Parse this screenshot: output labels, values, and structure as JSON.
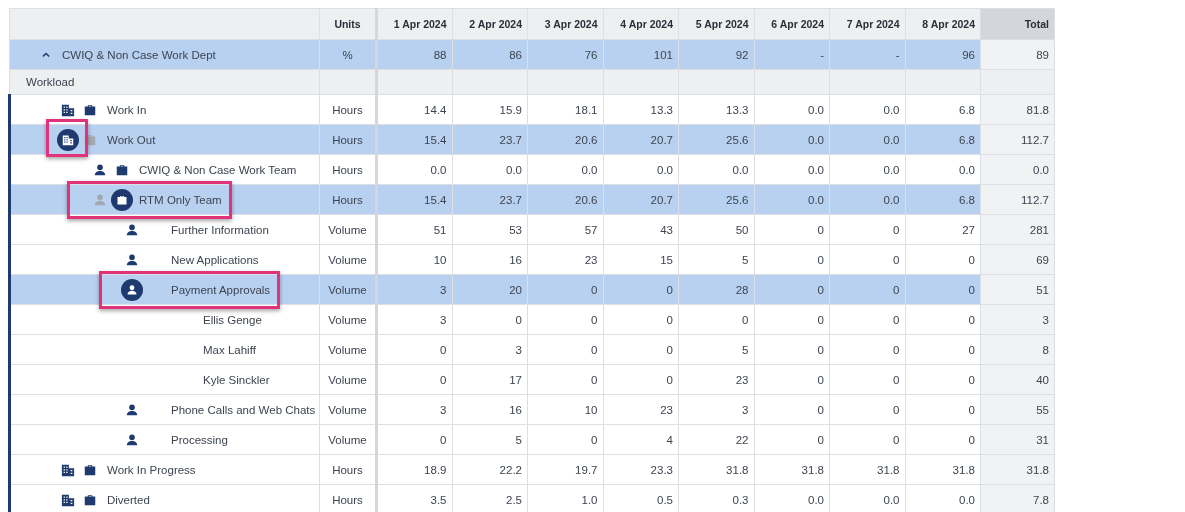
{
  "table": {
    "columns": [
      "Units",
      "1 Apr 2024",
      "2 Apr 2024",
      "3 Apr 2024",
      "4 Apr 2024",
      "5 Apr 2024",
      "6 Apr 2024",
      "7 Apr 2024",
      "8 Apr 2024",
      "Total"
    ],
    "dept": {
      "label": "CWIQ & Non Case Work Dept",
      "expanded": true,
      "selected": true,
      "units": "%",
      "values": [
        "88",
        "86",
        "76",
        "101",
        "92",
        "-",
        "-",
        "96"
      ],
      "total": "89"
    },
    "section": {
      "label": "Workload"
    },
    "rows": [
      {
        "label": "Work In",
        "selected": false,
        "icon_framed": false,
        "label_framed": false,
        "icons": [
          {
            "kind": "building",
            "circled": false,
            "faded": false
          },
          {
            "kind": "briefcase",
            "circled": false,
            "faded": false
          }
        ],
        "units": "Hours",
        "values": [
          "14.4",
          "15.9",
          "18.1",
          "13.3",
          "13.3",
          "0.0",
          "0.0",
          "6.8"
        ],
        "total": "81.8"
      },
      {
        "label": "Work Out",
        "selected": true,
        "icon_framed": true,
        "label_framed": false,
        "icons": [
          {
            "kind": "building",
            "circled": true,
            "faded": false
          },
          {
            "kind": "briefcase",
            "circled": false,
            "faded": true
          }
        ],
        "units": "Hours",
        "values": [
          "15.4",
          "23.7",
          "20.6",
          "20.7",
          "25.6",
          "0.0",
          "0.0",
          "6.8"
        ],
        "total": "112.7",
        "children": [
          {
            "label": "CWIQ & Non Case Work Team",
            "selected": false,
            "icon_framed": false,
            "label_framed": false,
            "icons": [
              {
                "kind": "person",
                "circled": false,
                "faded": false
              },
              {
                "kind": "briefcase",
                "circled": false,
                "faded": false
              }
            ],
            "units": "Hours",
            "values": [
              "0.0",
              "0.0",
              "0.0",
              "0.0",
              "0.0",
              "0.0",
              "0.0",
              "0.0"
            ],
            "total": "0.0"
          },
          {
            "label": "RTM Only Team",
            "selected": true,
            "icon_framed": false,
            "label_framed": true,
            "icons": [
              {
                "kind": "person",
                "circled": false,
                "faded": true
              },
              {
                "kind": "briefcase",
                "circled": true,
                "faded": false
              }
            ],
            "units": "Hours",
            "values": [
              "15.4",
              "23.7",
              "20.6",
              "20.7",
              "25.6",
              "0.0",
              "0.0",
              "6.8"
            ],
            "total": "112.7",
            "children": [
              {
                "label": "Further Information",
                "selected": false,
                "icon_framed": false,
                "label_framed": false,
                "icons": [
                  {
                    "kind": "person",
                    "circled": false,
                    "faded": false
                  }
                ],
                "units": "Volume",
                "values": [
                  "51",
                  "53",
                  "57",
                  "43",
                  "50",
                  "0",
                  "0",
                  "27"
                ],
                "total": "281"
              },
              {
                "label": "New Applications",
                "selected": false,
                "icon_framed": false,
                "label_framed": false,
                "icons": [
                  {
                    "kind": "person",
                    "circled": false,
                    "faded": false
                  }
                ],
                "units": "Volume",
                "values": [
                  "10",
                  "16",
                  "23",
                  "15",
                  "5",
                  "0",
                  "0",
                  "0"
                ],
                "total": "69"
              },
              {
                "label": "Payment Approvals",
                "selected": true,
                "icon_framed": false,
                "label_framed": true,
                "icons": [
                  {
                    "kind": "person",
                    "circled": true,
                    "faded": false
                  }
                ],
                "units": "Volume",
                "values": [
                  "3",
                  "20",
                  "0",
                  "0",
                  "28",
                  "0",
                  "0",
                  "0"
                ],
                "total": "51",
                "children": [
                  {
                    "label": "Ellis Genge",
                    "selected": false,
                    "icon_framed": false,
                    "label_framed": false,
                    "units": "Volume",
                    "values": [
                      "3",
                      "0",
                      "0",
                      "0",
                      "0",
                      "0",
                      "0",
                      "0"
                    ],
                    "total": "3"
                  },
                  {
                    "label": "Max Lahiff",
                    "selected": false,
                    "icon_framed": false,
                    "label_framed": false,
                    "units": "Volume",
                    "values": [
                      "0",
                      "3",
                      "0",
                      "0",
                      "5",
                      "0",
                      "0",
                      "0"
                    ],
                    "total": "8"
                  },
                  {
                    "label": "Kyle Sinckler",
                    "selected": false,
                    "icon_framed": false,
                    "label_framed": false,
                    "units": "Volume",
                    "values": [
                      "0",
                      "17",
                      "0",
                      "0",
                      "23",
                      "0",
                      "0",
                      "0"
                    ],
                    "total": "40"
                  }
                ]
              },
              {
                "label": "Phone Calls and Web Chats",
                "selected": false,
                "icon_framed": false,
                "label_framed": false,
                "icons": [
                  {
                    "kind": "person",
                    "circled": false,
                    "faded": false
                  }
                ],
                "units": "Volume",
                "values": [
                  "3",
                  "16",
                  "10",
                  "23",
                  "3",
                  "0",
                  "0",
                  "0"
                ],
                "total": "55"
              },
              {
                "label": "Processing",
                "selected": false,
                "icon_framed": false,
                "label_framed": false,
                "icons": [
                  {
                    "kind": "person",
                    "circled": false,
                    "faded": false
                  }
                ],
                "units": "Volume",
                "values": [
                  "0",
                  "5",
                  "0",
                  "4",
                  "22",
                  "0",
                  "0",
                  "0"
                ],
                "total": "31"
              }
            ]
          }
        ]
      },
      {
        "label": "Work In Progress",
        "selected": false,
        "icon_framed": false,
        "label_framed": false,
        "icons": [
          {
            "kind": "building",
            "circled": false,
            "faded": false
          },
          {
            "kind": "briefcase",
            "circled": false,
            "faded": false
          }
        ],
        "units": "Hours",
        "values": [
          "18.9",
          "22.2",
          "19.7",
          "23.3",
          "31.8",
          "31.8",
          "31.8",
          "31.8"
        ],
        "total": "31.8"
      },
      {
        "label": "Diverted",
        "selected": false,
        "icon_framed": false,
        "label_framed": false,
        "icons": [
          {
            "kind": "building",
            "circled": false,
            "faded": false
          },
          {
            "kind": "briefcase",
            "circled": false,
            "faded": false
          }
        ],
        "units": "Hours",
        "values": [
          "3.5",
          "2.5",
          "1.0",
          "0.5",
          "0.3",
          "0.0",
          "0.0",
          "0.0"
        ],
        "total": "7.8"
      }
    ]
  }
}
